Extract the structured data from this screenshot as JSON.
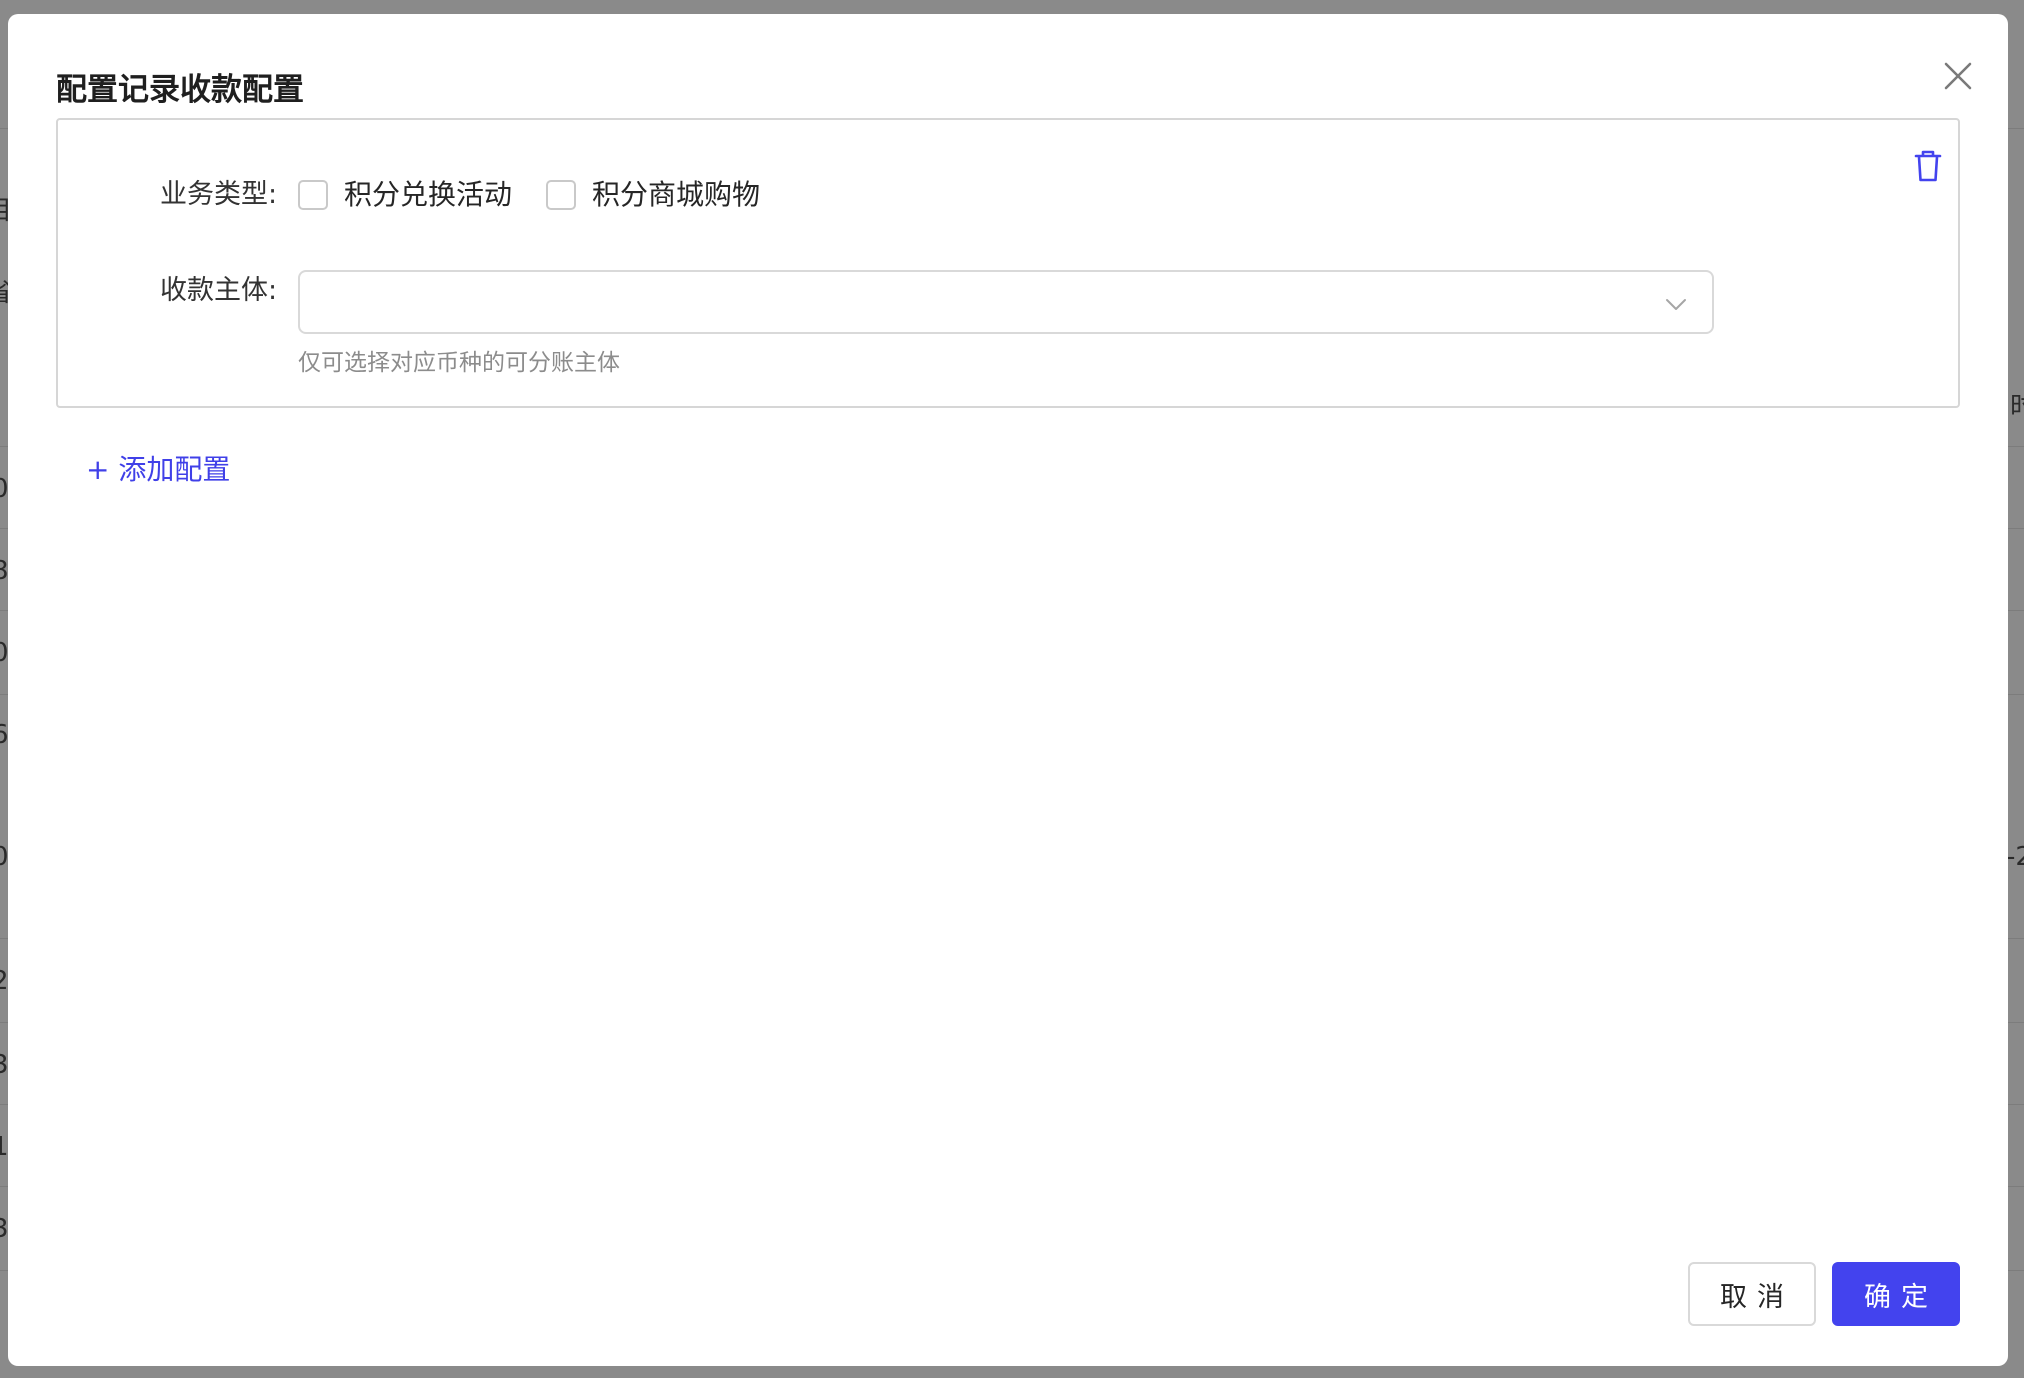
{
  "dialog": {
    "title": "配置记录收款配置"
  },
  "config": {
    "business_type_label": "业务类型:",
    "business_options": [
      {
        "label": "积分兑换活动",
        "checked": false
      },
      {
        "label": "积分商城购物",
        "checked": false
      }
    ],
    "payee_label": "收款主体:",
    "payee_value": "",
    "payee_hint": "仅可选择对应币种的可分账主体"
  },
  "add_config_label": "+ 添加配置",
  "footer": {
    "cancel_label": "取消",
    "confirm_label": "确定"
  },
  "background_fragments": [
    "目",
    "省",
    "时",
    "0",
    "8",
    "0",
    "6",
    "0",
    "-2",
    "2",
    "3",
    "1",
    "3"
  ],
  "colors": {
    "accent": "#4343ee",
    "link": "#4040e8",
    "overlay": "#8a8a8a"
  }
}
